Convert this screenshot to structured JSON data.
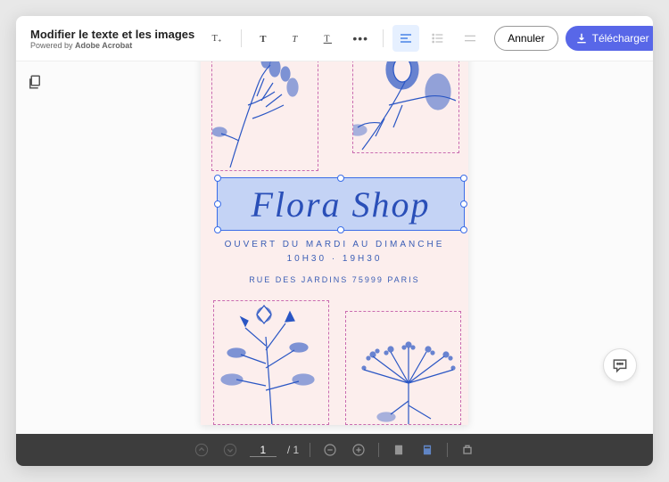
{
  "header": {
    "title": "Modifier le texte et les images",
    "powered_by_prefix": "Powered by ",
    "powered_by_brand": "Adobe Acrobat"
  },
  "actions": {
    "cancel": "Annuler",
    "download": "Télécharger"
  },
  "document": {
    "shop_name": "Flora Shop",
    "hours_line": "OUVERT DU MARDI AU DIMANCHE",
    "time_line": "10H30 · 19H30",
    "address_line": "RUE DES JARDINS 75999 PARIS"
  },
  "pager": {
    "current": "1",
    "total": "/ 1"
  }
}
